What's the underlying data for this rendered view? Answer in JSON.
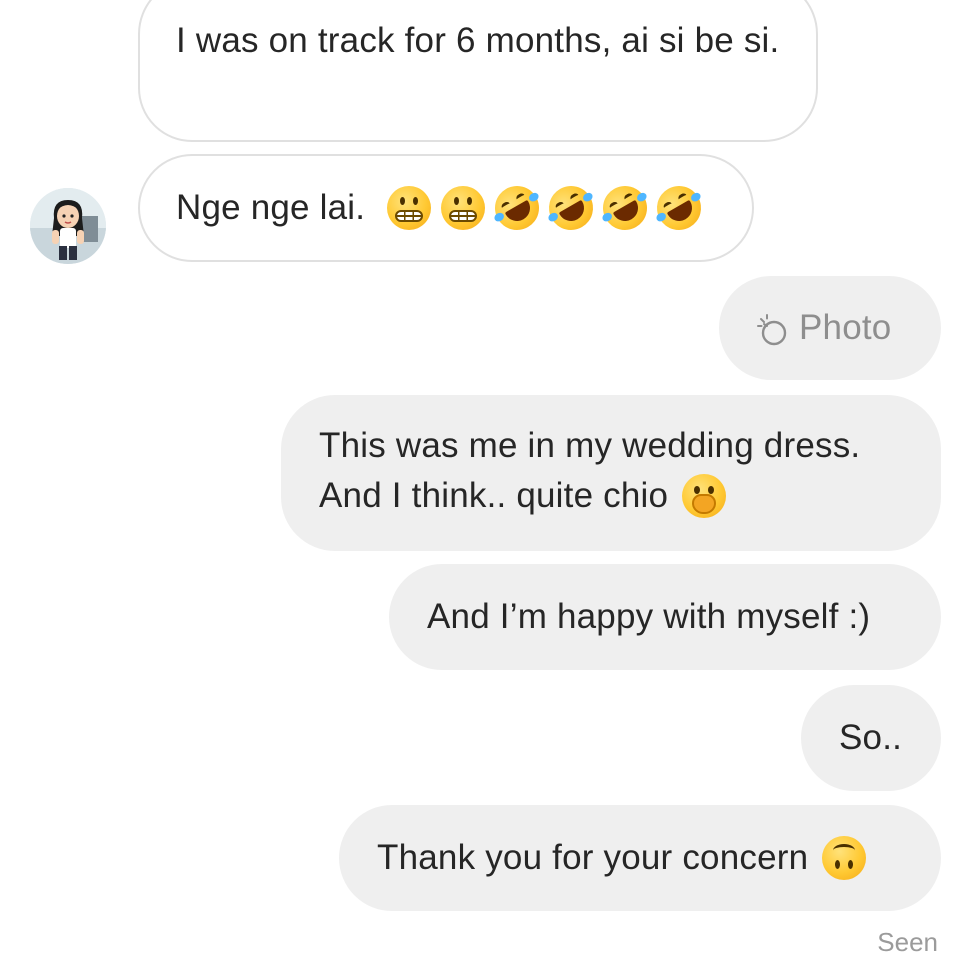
{
  "conversation": {
    "messages": [
      {
        "direction": "incoming",
        "text": "I was on track for 6 months, ai si be si."
      },
      {
        "direction": "incoming",
        "text": "Nge nge lai.",
        "emoji": [
          "grimacing-face",
          "grimacing-face",
          "rolling-on-floor-laughing",
          "rolling-on-floor-laughing",
          "rolling-on-floor-laughing",
          "rolling-on-floor-laughing"
        ]
      },
      {
        "direction": "outgoing",
        "type": "photo",
        "label": "Photo"
      },
      {
        "direction": "outgoing",
        "line1": "This was me in my wedding dress.",
        "line2": "And I think.. quite chio",
        "emoji": [
          "face-with-hand-over-mouth"
        ]
      },
      {
        "direction": "outgoing",
        "text": "And I’m happy with myself :)"
      },
      {
        "direction": "outgoing",
        "text": "So.."
      },
      {
        "direction": "outgoing",
        "text": "Thank you for your concern",
        "emoji": [
          "upside-down-face"
        ]
      }
    ],
    "status": "Seen"
  },
  "colors": {
    "incoming_bubble_bg": "#ffffff",
    "incoming_bubble_border": "#e0e0e0",
    "outgoing_bubble_bg": "#efefef",
    "text": "#262626",
    "muted_text": "#8e8e8e"
  },
  "icons": {
    "avatar": "bitmoji-avatar",
    "photo": "viewed-photo-icon"
  }
}
